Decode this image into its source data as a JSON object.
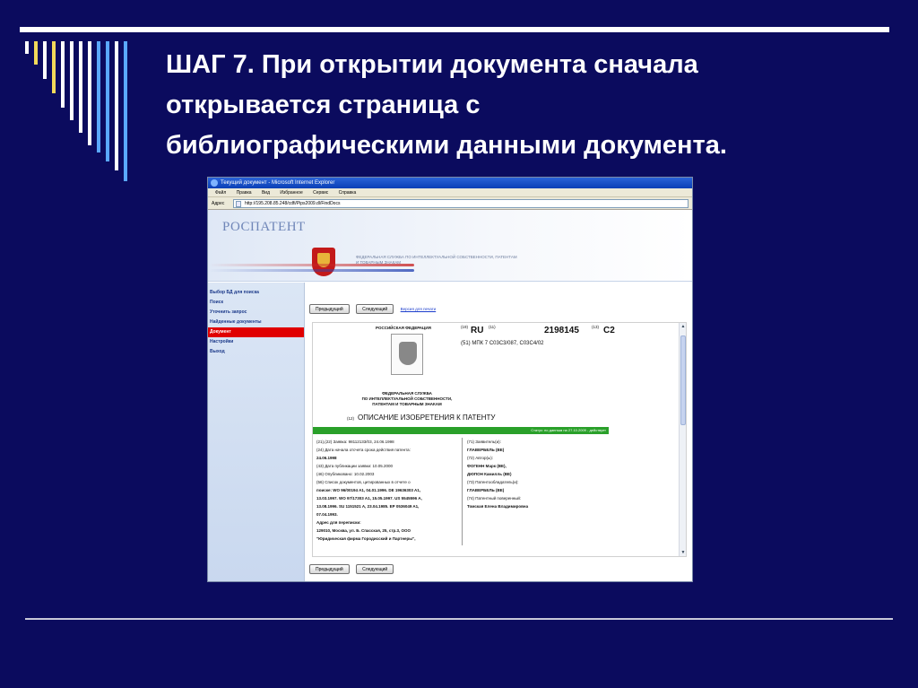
{
  "slide": {
    "title_lines": [
      "ШАГ 7. При открытии документа сначала",
      "открывается страница с",
      "библиографическими данными документа."
    ],
    "stripe_colors": [
      "#ffffff",
      "#f2d95a",
      "#ffffff",
      "#f2d95a",
      "#ffffff",
      "#ffffff",
      "#ffffff",
      "#ffffff",
      "#5aa8ff",
      "#5aa8ff",
      "#ffffff",
      "#5aa8ff"
    ]
  },
  "browser": {
    "window_title": "Текущий документ - Microsoft Internet Explorer",
    "menu": [
      "Файл",
      "Правка",
      "Вид",
      "Избранное",
      "Сервис",
      "Справка"
    ],
    "address_label": "Адрес",
    "address_value": "http://195.208.85.248/cdfi/Pips2009.dl/FindDocs",
    "banner": {
      "logo": "РОСПАТЕНТ",
      "agency_text": "ФЕДЕРАЛЬНАЯ СЛУЖБА ПО ИНТЕЛЛЕКТУАЛЬНОЙ СОБСТВЕННОСТИ, ПАТЕНТАМ И ТОВАРНЫМ ЗНАКАМ"
    },
    "sidebar_items": [
      {
        "label": "Выбор БД для поиска",
        "active": false
      },
      {
        "label": "Поиск",
        "active": false
      },
      {
        "label": "Уточнить запрос",
        "active": false
      },
      {
        "label": "Найденные документы",
        "active": false
      },
      {
        "label": "Документ",
        "active": true
      },
      {
        "label": "Настройки",
        "active": false
      },
      {
        "label": "Выход",
        "active": false
      }
    ],
    "nav": {
      "prev_label": "Предыдущий",
      "next_label": "Следующий",
      "print_link": "Версия для печати"
    },
    "document": {
      "country": "РОССИЙСКАЯ ФЕДЕРАЦИЯ",
      "service": [
        "ФЕДЕРАЛЬНАЯ СЛУЖБА",
        "ПО ИНТЕЛЛЕКТУАЛЬНОЙ СОБСТВЕННОСТИ,",
        "ПАТЕНТАМ И ТОВАРНЫМ ЗНАКАМ"
      ],
      "code19": "(19)",
      "country_code": "RU",
      "code11": "(11)",
      "patent_number": "2198145",
      "code13": "(13)",
      "kind": "C2",
      "ipc": "(51) МПК 7    C03C3/087, C03C4/02",
      "heading_code": "(12)",
      "heading": "ОПИСАНИЕ ИЗОБРЕТЕНИЯ К ПАТЕНТУ",
      "status": "Статус: по данным на 27.10.2009 - действует",
      "left_fields": [
        "(21),(22) Заявка: 98112133/03, 24.06.1998",
        "(24) Дата начала отсчета срока действия патента:",
        "24.06.1998",
        "(43) Дата публикации заявки: 10.05.2000",
        "(46) Опубликовано: 10.02.2003",
        "(56) Список документов, цитированных в отчете о",
        "поиске: WO 96/00194 A1, 04.01.1996. DE 19636303 A1,",
        "13.03.1997. WO 97/17303 A1, 15.05.1997. US 5545596 A,",
        "13.08.1996. SU 1151521 A, 23.04.1985. EP 0536049 A1,",
        "07.04.1993.",
        "Адрес для переписки:",
        "129010, Москва, ул. Б. Спасская, 25, стр.3, ООО",
        "\"Юридическая фирма Городисский и Партнеры\","
      ],
      "right_fields": [
        "(71) Заявитель(и):",
        "ГЛАВЕРБЕЛЬ (BE)",
        "(72) Автор(ы):",
        "ФОГЕНН Марк (BE),",
        "ДЮПОН Камилль (BE)",
        "(73) Патентообладатель(и):",
        "ГЛАВЕРБЕЛЬ (BE)",
        "(74) Патентный поверенный:",
        "Томская Елена Владимировна"
      ]
    }
  }
}
